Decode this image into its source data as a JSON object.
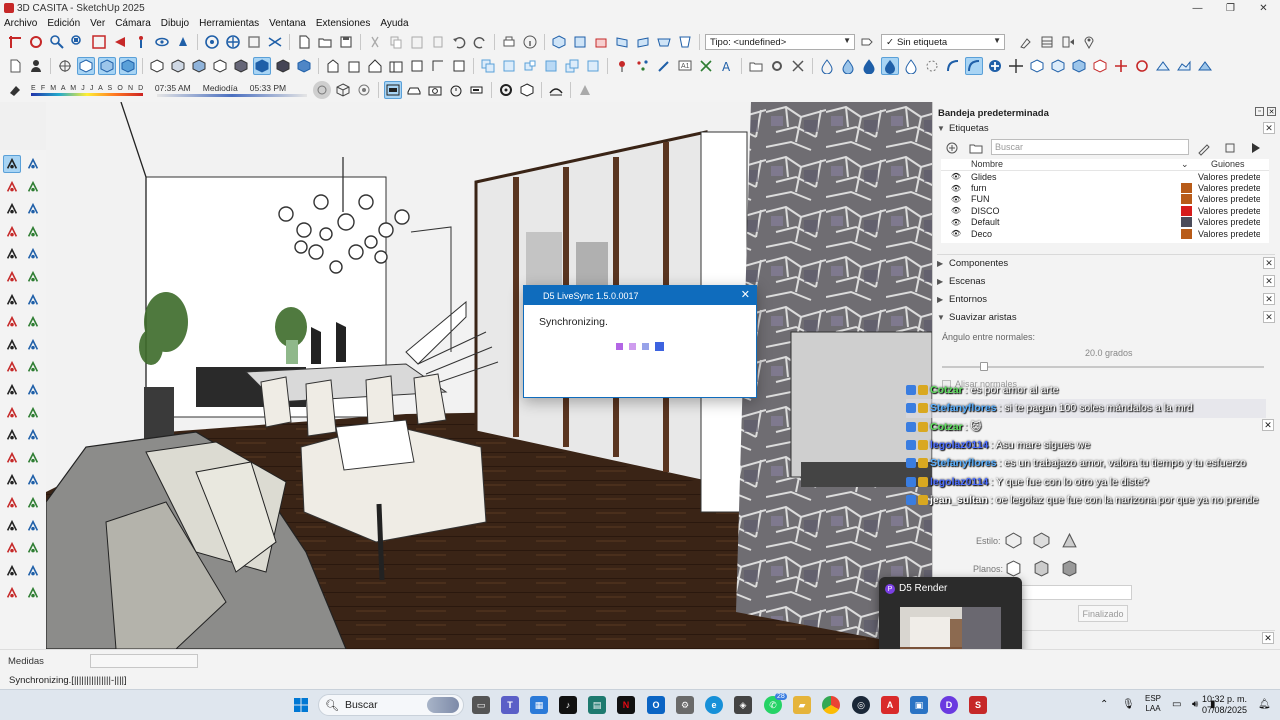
{
  "window": {
    "title": "3D CASITA - SketchUp 2025",
    "min": "—",
    "max": "❐",
    "close": "✕"
  },
  "menu": [
    "Archivo",
    "Edición",
    "Ver",
    "Cámara",
    "Dibujo",
    "Herramientas",
    "Ventana",
    "Extensiones",
    "Ayuda"
  ],
  "toolbar": {
    "type_combo": "Tipo: <undefined>",
    "tag_combo": "Sin etiqueta",
    "tag_check": "✓",
    "months": "E F M A M J J A S O N D",
    "time_start": "07:35 AM",
    "time_mid": "Mediodía",
    "time_end": "05:33 PM"
  },
  "tray": {
    "title": "Bandeja predeterminada",
    "sections": {
      "etiquetas": "Etiquetas",
      "componentes": "Componentes",
      "escenas": "Escenas",
      "entornos": "Entornos",
      "suavizar": "Suavizar aristas"
    },
    "tag_search_placeholder": "Buscar",
    "tag_headers": {
      "name": "Nombre",
      "lines": "Guiones"
    },
    "tags": [
      {
        "name": "Glides",
        "color": "#ffffff",
        "line": "Valores predete"
      },
      {
        "name": "furn",
        "color": "#b85b18",
        "line": "Valores predete"
      },
      {
        "name": "FUN",
        "color": "#b85b18",
        "line": "Valores predete"
      },
      {
        "name": "DISCO",
        "color": "#d61c1c",
        "line": "Valores predete"
      },
      {
        "name": "Default",
        "color": "#4c4c5a",
        "line": "Valores predete"
      },
      {
        "name": "Deco",
        "color": "#b85b18",
        "line": "Valores predete"
      }
    ],
    "smooth": {
      "angle_label": "Ángulo entre normales:",
      "angle_value": "20.0 grados",
      "angle_fraction": 0.13,
      "normals_label": "Alisar normales"
    },
    "style_label": "Estilo:",
    "planes_label": "Planos:",
    "done_label": "Finalizado"
  },
  "dialog": {
    "title": "D5 LiveSync 1.5.0.0017",
    "message": "Synchronizing.",
    "close": "✕"
  },
  "chat": [
    {
      "user": "Cotzar",
      "text": ": es por amor al arte",
      "highlight": false,
      "ucolor": "#5ee05e"
    },
    {
      "user": "Stefanyflores",
      "text": ": si te pagan 100 soles mándalos a la mrd",
      "highlight": true,
      "ucolor": "#5ab0ff"
    },
    {
      "user": "Cotzar",
      "text": ": 😺",
      "highlight": false,
      "ucolor": "#5ee05e"
    },
    {
      "user": "legolaz0114",
      "text": ": Asu mare sigues we",
      "highlight": false,
      "ucolor": "#4a6cff"
    },
    {
      "user": "Stefanyflores",
      "text": ": es un trabajazo amor, valora tu tiempo y tu esfuerzo",
      "highlight": false,
      "ucolor": "#5ab0ff"
    },
    {
      "user": "legolaz0114",
      "text": ": Y que fue con lo otro ya le diste?",
      "highlight": false,
      "ucolor": "#4a6cff"
    },
    {
      "user": "jean_sultan",
      "text": ": oe legolaz que fue con la narizona por que ya no prende",
      "highlight": false,
      "ucolor": "#ffffff"
    }
  ],
  "thumb": {
    "label": "D5 Render",
    "icon": "P"
  },
  "measures": {
    "label": "Medidas"
  },
  "status": {
    "text": "Synchronizing.[|||||||||||||||-||||]"
  },
  "taskbar": {
    "search": "Buscar",
    "lang_top": "ESP",
    "lang_bottom": "LAA",
    "time": "10:32 p. m.",
    "date": "07/08/2025",
    "icons": [
      "windows-start-icon",
      "file-explorer-icon",
      "teams-icon",
      "store-icon",
      "tiktok-icon",
      "netflix-icon",
      "outlook-icon",
      "settings-icon",
      "edge-icon",
      "xbox-icon",
      "whatsapp-icon",
      "folder-icon",
      "chrome-icon",
      "steam-icon",
      "acrobat-icon",
      "sketchup-icon",
      "d5-render-icon",
      "sketchup-alt-icon"
    ],
    "whatsapp_badge": "28"
  }
}
